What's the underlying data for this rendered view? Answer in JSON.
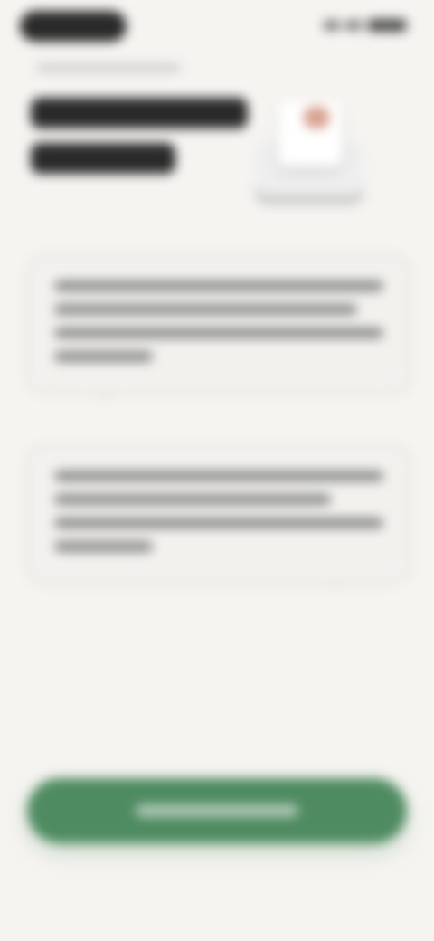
{
  "theme": {
    "background": "#f6f4f1",
    "accent": "#4f8b61",
    "card_border": "#dbd9d5"
  },
  "status_bar": {
    "left_pill": "",
    "right_indicators": ""
  },
  "header": {
    "subline": "",
    "title_line_1": "",
    "title_line_2": "",
    "illustration_icon": "document-stamp-illustration-icon"
  },
  "cards": [
    {
      "text": ""
    },
    {
      "text": ""
    }
  ],
  "cta": {
    "label": ""
  }
}
